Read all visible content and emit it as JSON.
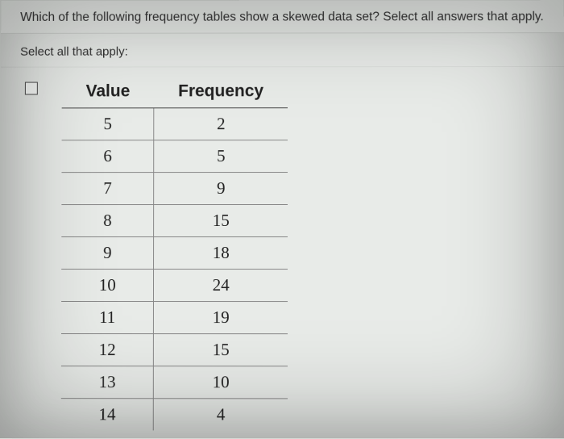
{
  "question": "Which of the following frequency tables show a skewed data set? Select all answers that apply.",
  "instruction": "Select all that apply:",
  "table": {
    "headers": {
      "col1": "Value",
      "col2": "Frequency"
    },
    "rows": [
      {
        "value": "5",
        "freq": "2"
      },
      {
        "value": "6",
        "freq": "5"
      },
      {
        "value": "7",
        "freq": "9"
      },
      {
        "value": "8",
        "freq": "15"
      },
      {
        "value": "9",
        "freq": "18"
      },
      {
        "value": "10",
        "freq": "24"
      },
      {
        "value": "11",
        "freq": "19"
      },
      {
        "value": "12",
        "freq": "15"
      },
      {
        "value": "13",
        "freq": "10"
      },
      {
        "value": "14",
        "freq": "4"
      }
    ]
  },
  "chart_data": {
    "type": "table",
    "title": "Frequency table",
    "columns": [
      "Value",
      "Frequency"
    ],
    "data": [
      [
        5,
        2
      ],
      [
        6,
        5
      ],
      [
        7,
        9
      ],
      [
        8,
        15
      ],
      [
        9,
        18
      ],
      [
        10,
        24
      ],
      [
        11,
        19
      ],
      [
        12,
        15
      ],
      [
        13,
        10
      ],
      [
        14,
        4
      ]
    ]
  }
}
